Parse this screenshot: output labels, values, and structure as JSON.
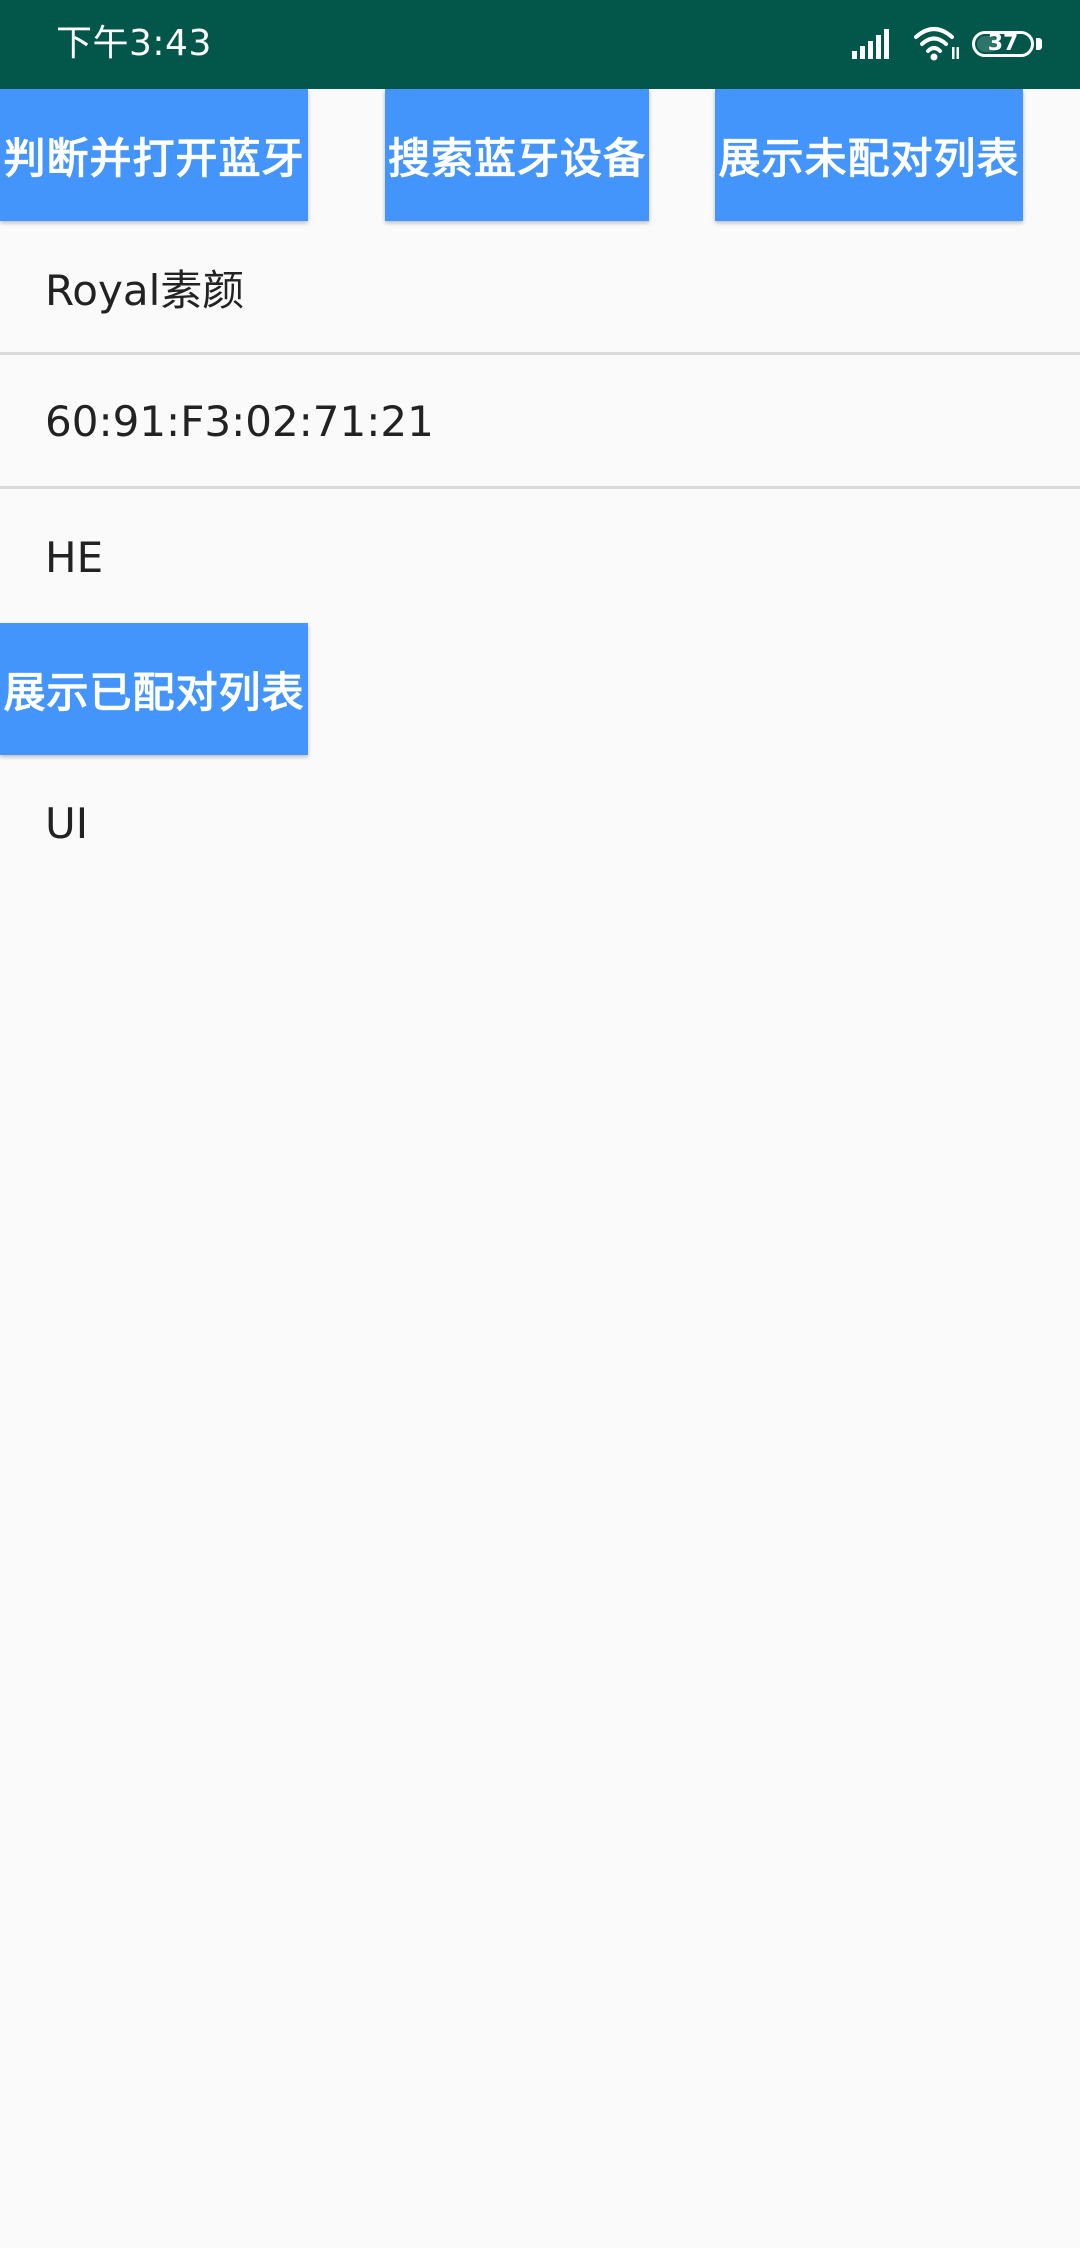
{
  "status_bar": {
    "time": "下午3:43",
    "battery_level": "37",
    "background_color": "#02564a",
    "icons": [
      "signal-icon",
      "wifi-icon",
      "battery-icon"
    ]
  },
  "buttons": {
    "open_bluetooth": "判断并打开蓝牙",
    "search_devices": "搜索蓝牙设备",
    "show_unpaired": "展示未配对列表",
    "show_paired": "展示已配对列表",
    "color": "#4495fb"
  },
  "unpaired_list": [
    "Royal素颜",
    "60:91:F3:02:71:21",
    "HE"
  ],
  "paired_list": [
    "UI"
  ]
}
